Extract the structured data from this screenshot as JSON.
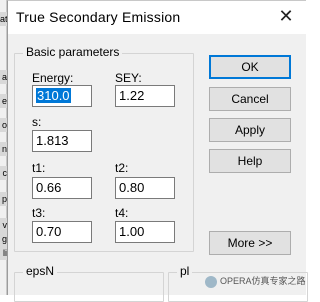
{
  "background": {
    "fragments": [
      "at",
      "a",
      "e",
      "o",
      "n",
      "c",
      "p",
      "v",
      "g",
      "li"
    ]
  },
  "dialog": {
    "title": "True Secondary Emission",
    "close_glyph": "✕",
    "basic_group": "Basic parameters",
    "fields": {
      "energy": {
        "label": "Energy:",
        "value": "310.0"
      },
      "sey": {
        "label": "SEY:",
        "value": "1.22"
      },
      "s": {
        "label": "s:",
        "value": "1.813"
      },
      "t1": {
        "label": "t1:",
        "value": "0.66"
      },
      "t2": {
        "label": "t2:",
        "value": "0.80"
      },
      "t3": {
        "label": "t3:",
        "value": "0.70"
      },
      "t4": {
        "label": "t4:",
        "value": "1.00"
      }
    },
    "buttons": {
      "ok": "OK",
      "cancel": "Cancel",
      "apply": "Apply",
      "help": "Help",
      "more": "More >>"
    },
    "bottom_groups": {
      "left": "epsN",
      "right": "pl"
    }
  },
  "watermark": {
    "text": "OPERA仿真专家之路"
  },
  "colors": {
    "selection": "#0078d7",
    "dialog_bg": "#f0f0f0"
  }
}
